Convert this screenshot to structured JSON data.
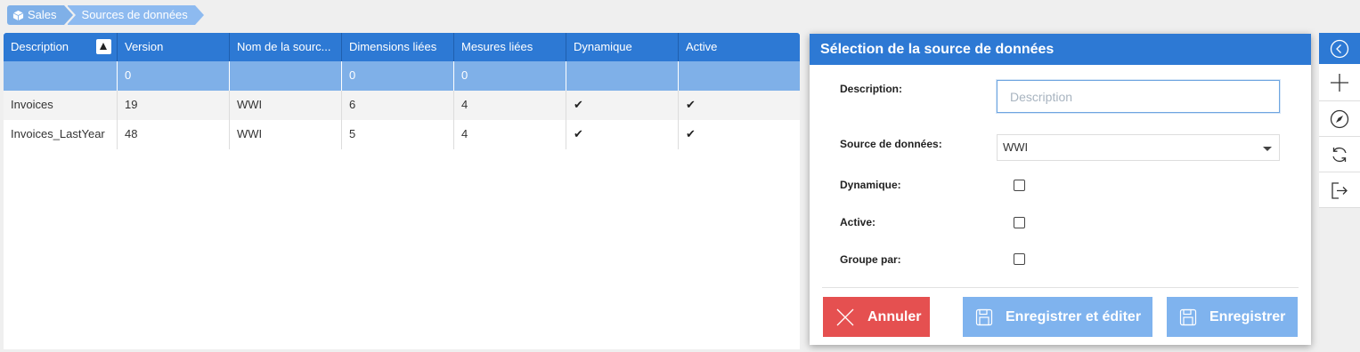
{
  "breadcrumb": [
    {
      "label": "Sales",
      "icon": "cube-icon"
    },
    {
      "label": "Sources de données"
    }
  ],
  "grid": {
    "columns": [
      "Description",
      "Version",
      "Nom de la sourc...",
      "Dimensions liées",
      "Mesures liées",
      "Dynamique",
      "Active"
    ],
    "sorted_column": "Description",
    "sort_direction": "ascending",
    "filter_row": [
      "",
      "0",
      "",
      "0",
      "0",
      "",
      ""
    ],
    "rows": [
      {
        "description": "Invoices",
        "version": "19",
        "source": "WWI",
        "dimensions": "6",
        "mesures": "4",
        "dynamique": "✔",
        "active": "✔"
      },
      {
        "description": "Invoices_LastYear",
        "version": "48",
        "source": "WWI",
        "dimensions": "5",
        "mesures": "4",
        "dynamique": "✔",
        "active": "✔"
      }
    ]
  },
  "modal": {
    "title": "Sélection de la source de données",
    "description_label": "Description:",
    "description_placeholder": "Description",
    "description_value": "",
    "source_label": "Source de données:",
    "source_value": "WWI",
    "dynamique_label": "Dynamique:",
    "dynamique_checked": false,
    "active_label": "Active:",
    "active_checked": false,
    "groupe_label": "Groupe par:",
    "groupe_checked": false,
    "cancel_label": "Annuler",
    "save_edit_label": "Enregistrer et éditer",
    "save_label": "Enregistrer"
  },
  "toolbar": {
    "icons": [
      "back-circle-icon",
      "plus-icon",
      "compass-icon",
      "refresh-icon",
      "exit-icon"
    ]
  },
  "colors": {
    "header_blue": "#2d79d4",
    "light_blue": "#7fb0e8",
    "cancel_red": "#e55050",
    "save_blue": "#7fb3ee"
  }
}
